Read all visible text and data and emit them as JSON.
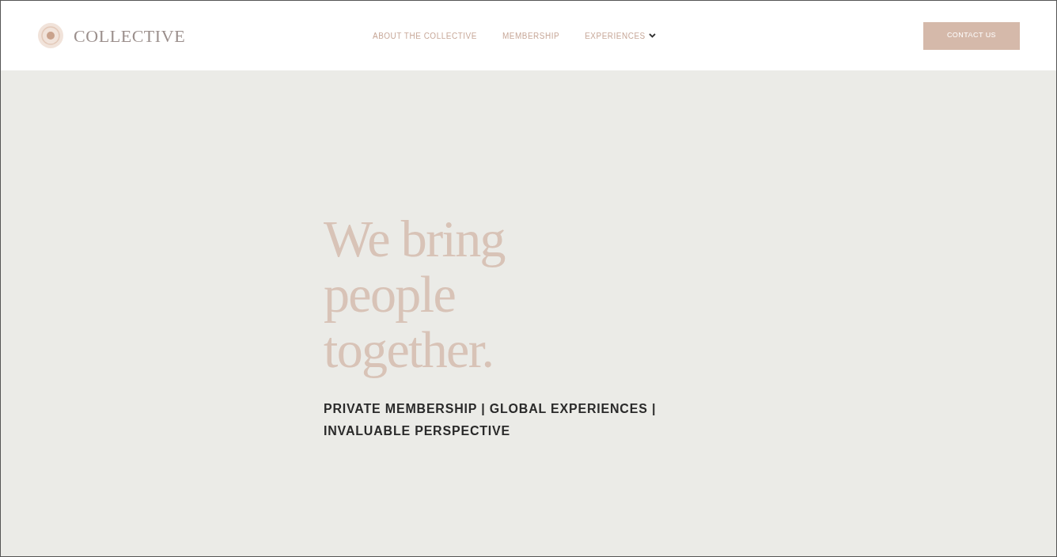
{
  "logo": {
    "text": "COLLECTIVE"
  },
  "nav": [
    {
      "label": "ABOUT THE COLLECTIVE",
      "dropdown": false
    },
    {
      "label": "MEMBERSHIP",
      "dropdown": false
    },
    {
      "label": "EXPERIENCES",
      "dropdown": true
    }
  ],
  "cta": {
    "label": "CONTACT US"
  },
  "hero": {
    "headline": [
      "We bring",
      "people",
      "together."
    ],
    "tagline": [
      "PRIVATE MEMBERSHIP | GLOBAL EXPERIENCES |",
      "INVALUABLE PERSPECTIVE"
    ]
  }
}
